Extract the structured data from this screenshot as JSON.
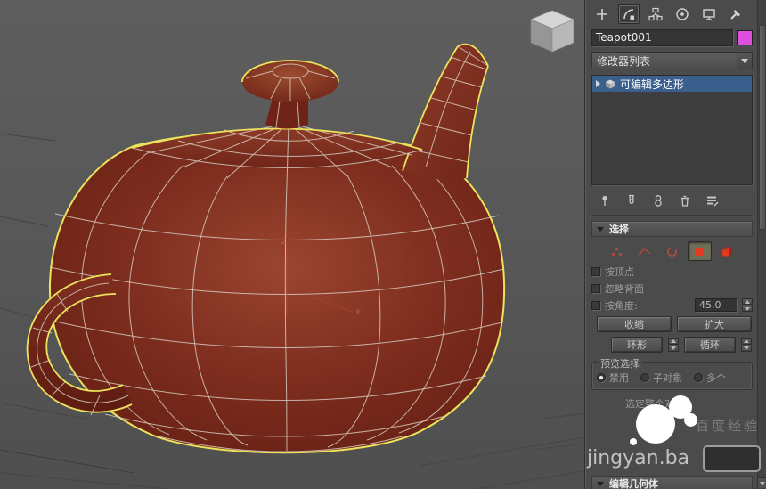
{
  "viewport": {
    "axis": {
      "z": "z",
      "x": "x"
    },
    "colors": {
      "background": "#575757",
      "teapot_body": "#7c2b1e",
      "selection_outline": "#ece25c",
      "wireframe": "#d9cfc2"
    }
  },
  "panel": {
    "tabs": [
      {
        "icon": "create"
      },
      {
        "icon": "modify",
        "active": true
      },
      {
        "icon": "hierarchy"
      },
      {
        "icon": "motion"
      },
      {
        "icon": "display"
      },
      {
        "icon": "utilities"
      }
    ],
    "object_name": "Teapot001",
    "object_color": "#df4fdd",
    "modifier_list": "修改器列表",
    "stack_rows": [
      {
        "label": "可编辑多边形",
        "selected": true
      }
    ],
    "stack_tools": [
      "pin-stack",
      "show-end-result",
      "make-unique",
      "remove-modifier",
      "configure-modifier-sets"
    ],
    "selection": {
      "title": "选择",
      "subobject_modes": [
        "vertex",
        "edge",
        "border",
        "polygon",
        "element"
      ],
      "active_subobject": "polygon",
      "by_vertex": "按顶点",
      "ignore_backfacing": "忽略背面",
      "by_angle": "按角度:",
      "angle_value": "45.0",
      "shrink": "收缩",
      "grow": "扩大",
      "ring": "环形",
      "loop": "循环",
      "preview": {
        "title": "预览选择",
        "disable": "禁用",
        "subobj": "子对象",
        "multi": "多个",
        "selected": "禁用"
      },
      "status": "选定整个对象"
    },
    "edit_geometry_title": "编辑几何体",
    "colors": {
      "stack_selection": "#3a5f8c"
    }
  },
  "watermark": {
    "line": "jingyan.ba",
    "brand": "百度经验"
  }
}
